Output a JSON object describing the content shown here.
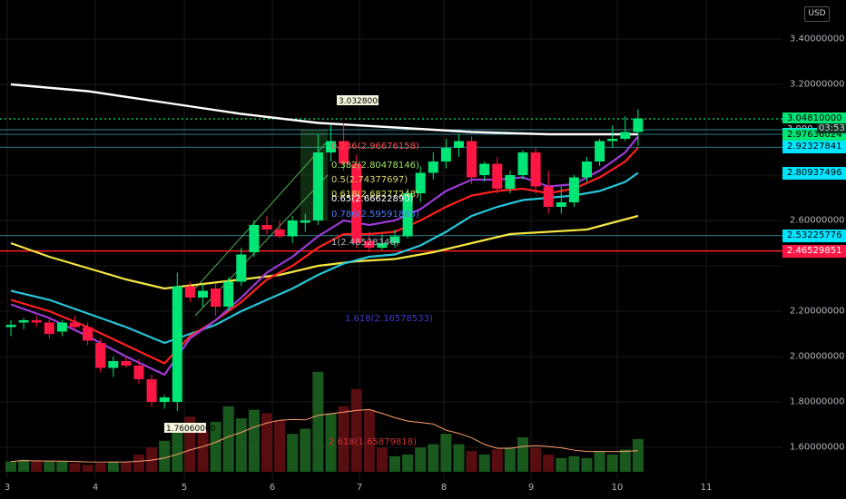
{
  "currency": "USD",
  "price_scale": [
    {
      "v": 3.4,
      "t": "3.40000000"
    },
    {
      "v": 3.2,
      "t": "3.20000000"
    },
    {
      "v": 2.6,
      "t": "2.60000000"
    },
    {
      "v": 2.2,
      "t": "2.20000000"
    },
    {
      "v": 2.0,
      "t": "2.00000000"
    },
    {
      "v": 1.8,
      "t": "1.80000000"
    },
    {
      "v": 1.6,
      "t": "1.60000000"
    }
  ],
  "price_labels": [
    {
      "v": 3.0481,
      "t": "3.04810000",
      "bg": "#00e676",
      "fg": "#000000"
    },
    {
      "v": 3.0,
      "t": "3.000",
      "bg": "#000000",
      "fg": "#d1d4dc"
    },
    {
      "v": 2.97967721,
      "t": "2.97967721",
      "bg": "#00e5ff",
      "fg": "#000000"
    },
    {
      "v": 2.97636024,
      "t": "2.97636024",
      "bg": "#00e676",
      "fg": "#000000"
    },
    {
      "v": 2.92327841,
      "t": "2.92327841",
      "bg": "#00e5ff",
      "fg": "#000000"
    },
    {
      "v": 2.80937496,
      "t": "2.80937496",
      "bg": "#00e5ff",
      "fg": "#000000"
    },
    {
      "v": 2.53258819,
      "t": "2.53258819",
      "bg": "#3a3a3a",
      "fg": "#d1d4dc"
    },
    {
      "v": 2.53225776,
      "t": "2.53225776",
      "bg": "#00e5ff",
      "fg": "#000000"
    },
    {
      "v": 2.46549767,
      "t": "2.46549767",
      "bg": "#ff1744",
      "fg": "#ffffff"
    },
    {
      "v": 2.46529851,
      "t": "2.46529851",
      "bg": "#ff1744",
      "fg": "#ffffff"
    }
  ],
  "countdown": "03:53",
  "time_labels": [
    "3",
    "4",
    "5",
    "6",
    "7",
    "8",
    "9",
    "10",
    "11"
  ],
  "annotations": {
    "high_marker": "3.03280000",
    "low_marker": "1.76060000",
    "fib": [
      {
        "text": "0.236(2.96676158)",
        "color": "#ff4d4d"
      },
      {
        "text": "0.382(2.80478146)",
        "color": "#a0e060"
      },
      {
        "text": "0.5(2.74377697)",
        "color": "#d6d66a"
      },
      {
        "text": "0.618(2.68277248)",
        "color": "#e0e060"
      },
      {
        "text": "0.65(2.66622890)",
        "color": "#ffffff"
      },
      {
        "text": "0.786(2.59591865)",
        "color": "#4d79ff"
      },
      {
        "text": "1(2.48528340)",
        "color": "#b2b5be"
      },
      {
        "text": "1.618(2.16578533)",
        "color": "#3d3dcc"
      },
      {
        "text": "2.618(1.65879818)",
        "color": "#cc3333"
      }
    ]
  },
  "colors": {
    "up": "#00e676",
    "down": "#ff1744",
    "ema_white": "#ffffff",
    "ema_yellow": "#f5e642",
    "ema_cyan": "#26c6da",
    "ema_red": "#ff1f1f",
    "ema_purple": "#9c3bd6",
    "hline": "#ff1f1f",
    "hline_cyan": "#4dd0e1",
    "dotted": "#00e676"
  },
  "chart_data": {
    "type": "candlestick",
    "ylim": [
      1.5,
      3.5
    ],
    "candles": [
      {
        "o": 2.13,
        "h": 2.16,
        "l": 2.09,
        "c": 2.14
      },
      {
        "o": 2.15,
        "h": 2.17,
        "l": 2.12,
        "c": 2.16
      },
      {
        "o": 2.16,
        "h": 2.18,
        "l": 2.13,
        "c": 2.15
      },
      {
        "o": 2.15,
        "h": 2.17,
        "l": 2.08,
        "c": 2.1
      },
      {
        "o": 2.11,
        "h": 2.16,
        "l": 2.09,
        "c": 2.15
      },
      {
        "o": 2.15,
        "h": 2.18,
        "l": 2.12,
        "c": 2.13
      },
      {
        "o": 2.13,
        "h": 2.15,
        "l": 2.05,
        "c": 2.07
      },
      {
        "o": 2.06,
        "h": 2.08,
        "l": 1.93,
        "c": 1.95
      },
      {
        "o": 1.95,
        "h": 2.0,
        "l": 1.91,
        "c": 1.98
      },
      {
        "o": 1.98,
        "h": 2.0,
        "l": 1.95,
        "c": 1.96
      },
      {
        "o": 1.96,
        "h": 1.99,
        "l": 1.88,
        "c": 1.9
      },
      {
        "o": 1.9,
        "h": 1.92,
        "l": 1.78,
        "c": 1.8
      },
      {
        "o": 1.8,
        "h": 1.83,
        "l": 1.77,
        "c": 1.82
      },
      {
        "o": 1.8,
        "h": 2.37,
        "l": 1.76,
        "c": 2.31
      },
      {
        "o": 2.31,
        "h": 2.33,
        "l": 2.24,
        "c": 2.26
      },
      {
        "o": 2.26,
        "h": 2.32,
        "l": 2.22,
        "c": 2.29
      },
      {
        "o": 2.3,
        "h": 2.32,
        "l": 2.18,
        "c": 2.22
      },
      {
        "o": 2.22,
        "h": 2.35,
        "l": 2.2,
        "c": 2.33
      },
      {
        "o": 2.33,
        "h": 2.48,
        "l": 2.31,
        "c": 2.45
      },
      {
        "o": 2.46,
        "h": 2.6,
        "l": 2.44,
        "c": 2.58
      },
      {
        "o": 2.58,
        "h": 2.62,
        "l": 2.54,
        "c": 2.56
      },
      {
        "o": 2.56,
        "h": 2.6,
        "l": 2.52,
        "c": 2.53
      },
      {
        "o": 2.53,
        "h": 2.62,
        "l": 2.5,
        "c": 2.6
      },
      {
        "o": 2.59,
        "h": 2.63,
        "l": 2.55,
        "c": 2.6
      },
      {
        "o": 2.6,
        "h": 2.98,
        "l": 2.58,
        "c": 2.9
      },
      {
        "o": 2.9,
        "h": 3.02,
        "l": 2.86,
        "c": 2.95
      },
      {
        "o": 2.95,
        "h": 3.03,
        "l": 2.82,
        "c": 2.85
      },
      {
        "o": 2.85,
        "h": 2.89,
        "l": 2.48,
        "c": 2.5
      },
      {
        "o": 2.51,
        "h": 2.55,
        "l": 2.46,
        "c": 2.48
      },
      {
        "o": 2.48,
        "h": 2.54,
        "l": 2.47,
        "c": 2.5
      },
      {
        "o": 2.5,
        "h": 2.56,
        "l": 2.48,
        "c": 2.53
      },
      {
        "o": 2.53,
        "h": 2.74,
        "l": 2.52,
        "c": 2.72
      },
      {
        "o": 2.72,
        "h": 2.84,
        "l": 2.68,
        "c": 2.81
      },
      {
        "o": 2.81,
        "h": 2.9,
        "l": 2.78,
        "c": 2.86
      },
      {
        "o": 2.86,
        "h": 2.96,
        "l": 2.83,
        "c": 2.92
      },
      {
        "o": 2.92,
        "h": 2.98,
        "l": 2.88,
        "c": 2.95
      },
      {
        "o": 2.95,
        "h": 2.97,
        "l": 2.76,
        "c": 2.79
      },
      {
        "o": 2.8,
        "h": 2.86,
        "l": 2.77,
        "c": 2.85
      },
      {
        "o": 2.85,
        "h": 2.88,
        "l": 2.72,
        "c": 2.74
      },
      {
        "o": 2.74,
        "h": 2.82,
        "l": 2.72,
        "c": 2.8
      },
      {
        "o": 2.8,
        "h": 2.91,
        "l": 2.78,
        "c": 2.9
      },
      {
        "o": 2.9,
        "h": 2.92,
        "l": 2.72,
        "c": 2.75
      },
      {
        "o": 2.75,
        "h": 2.82,
        "l": 2.63,
        "c": 2.66
      },
      {
        "o": 2.66,
        "h": 2.75,
        "l": 2.63,
        "c": 2.68
      },
      {
        "o": 2.68,
        "h": 2.8,
        "l": 2.66,
        "c": 2.79
      },
      {
        "o": 2.79,
        "h": 2.88,
        "l": 2.77,
        "c": 2.86
      },
      {
        "o": 2.86,
        "h": 2.96,
        "l": 2.84,
        "c": 2.95
      },
      {
        "o": 2.95,
        "h": 3.02,
        "l": 2.92,
        "c": 2.96
      },
      {
        "o": 2.96,
        "h": 3.06,
        "l": 2.95,
        "c": 2.99
      },
      {
        "o": 2.99,
        "h": 3.09,
        "l": 2.93,
        "c": 3.05
      }
    ],
    "volumes": [
      {
        "v": 0.3,
        "up": true
      },
      {
        "v": 0.35,
        "up": true
      },
      {
        "v": 0.3,
        "up": false
      },
      {
        "v": 0.3,
        "up": true
      },
      {
        "v": 0.3,
        "up": true
      },
      {
        "v": 0.25,
        "up": false
      },
      {
        "v": 0.2,
        "up": false
      },
      {
        "v": 0.25,
        "up": false
      },
      {
        "v": 0.3,
        "up": true
      },
      {
        "v": 0.3,
        "up": false
      },
      {
        "v": 0.5,
        "up": false
      },
      {
        "v": 0.7,
        "up": false
      },
      {
        "v": 0.9,
        "up": true
      },
      {
        "v": 1.35,
        "up": true
      },
      {
        "v": 1.6,
        "up": false
      },
      {
        "v": 1.2,
        "up": false
      },
      {
        "v": 1.45,
        "up": true
      },
      {
        "v": 1.9,
        "up": true
      },
      {
        "v": 1.55,
        "up": true
      },
      {
        "v": 1.8,
        "up": true
      },
      {
        "v": 1.7,
        "up": false
      },
      {
        "v": 1.5,
        "up": false
      },
      {
        "v": 1.1,
        "up": true
      },
      {
        "v": 1.25,
        "up": true
      },
      {
        "v": 2.9,
        "up": true
      },
      {
        "v": 1.7,
        "up": true
      },
      {
        "v": 1.9,
        "up": false
      },
      {
        "v": 2.4,
        "up": false
      },
      {
        "v": 1.8,
        "up": false
      },
      {
        "v": 0.7,
        "up": false
      },
      {
        "v": 0.45,
        "up": true
      },
      {
        "v": 0.5,
        "up": true
      },
      {
        "v": 0.7,
        "up": true
      },
      {
        "v": 0.8,
        "up": true
      },
      {
        "v": 1.1,
        "up": true
      },
      {
        "v": 0.8,
        "up": true
      },
      {
        "v": 0.6,
        "up": false
      },
      {
        "v": 0.5,
        "up": true
      },
      {
        "v": 0.65,
        "up": false
      },
      {
        "v": 0.7,
        "up": true
      },
      {
        "v": 1.0,
        "up": true
      },
      {
        "v": 0.7,
        "up": false
      },
      {
        "v": 0.5,
        "up": false
      },
      {
        "v": 0.4,
        "up": true
      },
      {
        "v": 0.45,
        "up": true
      },
      {
        "v": 0.4,
        "up": true
      },
      {
        "v": 0.6,
        "up": true
      },
      {
        "v": 0.5,
        "up": true
      },
      {
        "v": 0.65,
        "up": true
      },
      {
        "v": 0.95,
        "up": true
      }
    ],
    "ema_white": [
      [
        0,
        3.2
      ],
      [
        6,
        3.17
      ],
      [
        12,
        3.12
      ],
      [
        18,
        3.07
      ],
      [
        24,
        3.03
      ],
      [
        30,
        3.01
      ],
      [
        36,
        2.99
      ],
      [
        42,
        2.98
      ],
      [
        49,
        2.98
      ]
    ],
    "ema_yellow": [
      [
        0,
        2.5
      ],
      [
        3,
        2.44
      ],
      [
        6,
        2.39
      ],
      [
        9,
        2.34
      ],
      [
        12,
        2.3
      ],
      [
        15,
        2.32
      ],
      [
        18,
        2.34
      ],
      [
        21,
        2.36
      ],
      [
        24,
        2.4
      ],
      [
        27,
        2.42
      ],
      [
        30,
        2.43
      ],
      [
        33,
        2.46
      ],
      [
        36,
        2.5
      ],
      [
        39,
        2.54
      ],
      [
        42,
        2.55
      ],
      [
        45,
        2.56
      ],
      [
        49,
        2.62
      ]
    ],
    "ema_cyan": [
      [
        0,
        2.29
      ],
      [
        3,
        2.25
      ],
      [
        6,
        2.19
      ],
      [
        9,
        2.13
      ],
      [
        12,
        2.06
      ],
      [
        14,
        2.1
      ],
      [
        16,
        2.14
      ],
      [
        18,
        2.2
      ],
      [
        20,
        2.25
      ],
      [
        22,
        2.3
      ],
      [
        24,
        2.36
      ],
      [
        26,
        2.41
      ],
      [
        28,
        2.44
      ],
      [
        30,
        2.45
      ],
      [
        32,
        2.49
      ],
      [
        34,
        2.55
      ],
      [
        36,
        2.62
      ],
      [
        38,
        2.66
      ],
      [
        40,
        2.69
      ],
      [
        42,
        2.7
      ],
      [
        44,
        2.71
      ],
      [
        46,
        2.73
      ],
      [
        48,
        2.77
      ],
      [
        49,
        2.81
      ]
    ],
    "ema_red": [
      [
        0,
        2.25
      ],
      [
        3,
        2.2
      ],
      [
        6,
        2.13
      ],
      [
        9,
        2.05
      ],
      [
        12,
        1.97
      ],
      [
        13,
        2.03
      ],
      [
        14,
        2.09
      ],
      [
        16,
        2.16
      ],
      [
        18,
        2.24
      ],
      [
        20,
        2.34
      ],
      [
        22,
        2.4
      ],
      [
        24,
        2.48
      ],
      [
        26,
        2.54
      ],
      [
        28,
        2.54
      ],
      [
        30,
        2.55
      ],
      [
        32,
        2.6
      ],
      [
        34,
        2.66
      ],
      [
        36,
        2.71
      ],
      [
        38,
        2.73
      ],
      [
        40,
        2.74
      ],
      [
        42,
        2.72
      ],
      [
        44,
        2.74
      ],
      [
        46,
        2.79
      ],
      [
        48,
        2.86
      ],
      [
        49,
        2.92
      ]
    ],
    "ema_purple": [
      [
        0,
        2.23
      ],
      [
        3,
        2.17
      ],
      [
        6,
        2.09
      ],
      [
        9,
        2.0
      ],
      [
        12,
        1.92
      ],
      [
        13,
        2.0
      ],
      [
        14,
        2.08
      ],
      [
        16,
        2.16
      ],
      [
        18,
        2.26
      ],
      [
        20,
        2.37
      ],
      [
        22,
        2.44
      ],
      [
        24,
        2.53
      ],
      [
        26,
        2.6
      ],
      [
        28,
        2.58
      ],
      [
        30,
        2.6
      ],
      [
        32,
        2.65
      ],
      [
        34,
        2.73
      ],
      [
        36,
        2.78
      ],
      [
        38,
        2.78
      ],
      [
        40,
        2.79
      ],
      [
        42,
        2.75
      ],
      [
        44,
        2.76
      ],
      [
        46,
        2.82
      ],
      [
        48,
        2.9
      ],
      [
        49,
        2.97
      ]
    ]
  }
}
